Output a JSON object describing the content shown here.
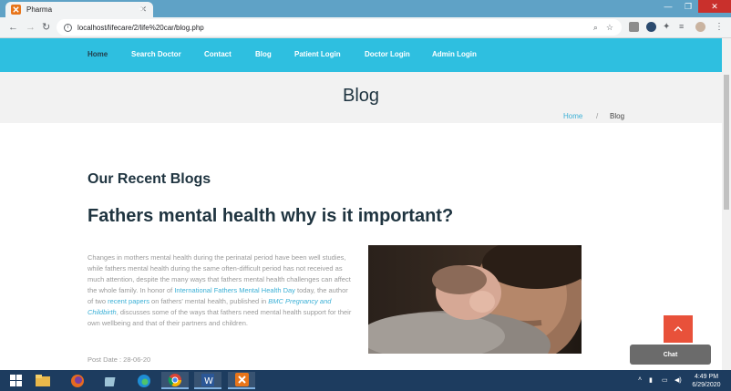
{
  "browser": {
    "tab_title": "Pharma",
    "tab_close": "✕",
    "new_tab": "+",
    "url": "localhost/lifecare/2/life%20car/blog.php"
  },
  "nav": {
    "items": [
      "Home",
      "Search Doctor",
      "Contact",
      "Blog",
      "Patient Login",
      "Doctor Login",
      "Admin Login"
    ]
  },
  "banner": {
    "title": "Blog",
    "breadcrumb_home": "Home",
    "breadcrumb_sep": "/",
    "breadcrumb_current": "Blog"
  },
  "content": {
    "section_heading": "Our Recent Blogs",
    "post_title": "Fathers mental health why is it important?",
    "body_1": "Changes in mothers mental health during the perinatal period have been well studies, while fathers mental health during the same often-difficult period has not received as much attention, despite the many ways that fathers mental health challenges can affect the whole family. In honor of ",
    "link_1": "International Fathers Mental Health Day",
    "body_2": " today, the author of two ",
    "link_2": "recent papers",
    "body_3": " on fathers' mental health, published in ",
    "link_3": "BMC Pregnancy and Childbirth",
    "body_4": ", discusses some of the ways that fathers need mental health support for their own wellbeing and that of their partners and children.",
    "post_date": "Post Date : 28-06-20"
  },
  "widgets": {
    "chat_label": "Chat"
  },
  "taskbar": {
    "time": "4:49 PM",
    "date": "6/29/2020"
  },
  "colors": {
    "navbar": "#2ebfe0",
    "nav_active": "#233d4a",
    "heading": "#1f3440",
    "link": "#3bb0d6",
    "scroll_top": "#e8513a",
    "chat": "#6b6b6b",
    "taskbar": "#1d3c5f"
  }
}
